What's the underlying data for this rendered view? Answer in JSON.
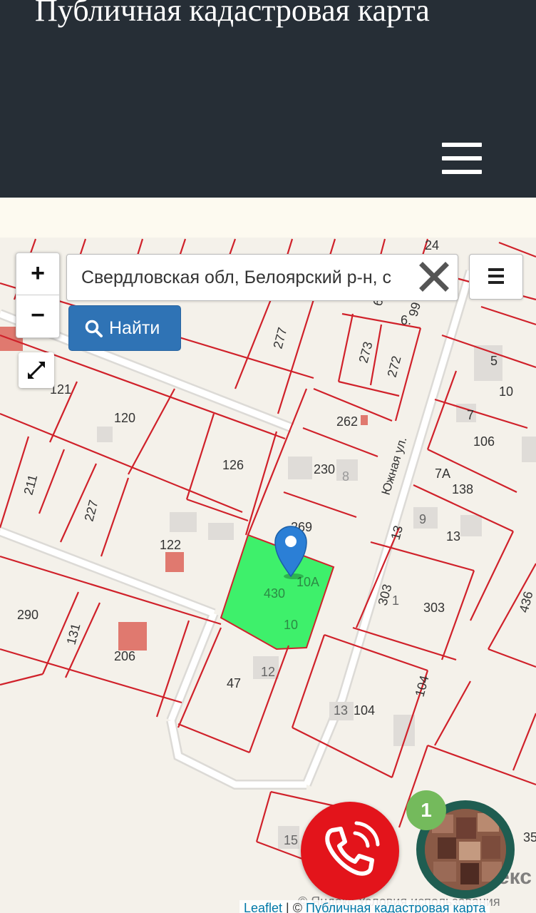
{
  "header": {
    "title": "Публичная кадастровая карта",
    "menu_icon": "hamburger-menu-icon",
    "background": "#262e36"
  },
  "map": {
    "zoom_in_label": "+",
    "zoom_out_label": "−",
    "search_value": "Свердловская обл, Белоярский р-н, с",
    "find_button_label": "Найти",
    "street_label": "Южная ул.",
    "selected_parcel": "430",
    "selected_color": "#3ef06b",
    "boundary_color": "#d0212a",
    "parcel_labels": [
      "24",
      "6",
      "99",
      "6.",
      "277",
      "273",
      "272",
      "5",
      "10",
      "121",
      "120",
      "262",
      "7",
      "106",
      "126",
      "230",
      "8",
      "7А",
      "138",
      "211",
      "227",
      "122",
      "269",
      "9",
      "13",
      "13",
      "10А",
      "430",
      "303",
      "1",
      "303",
      "436",
      "290",
      "131",
      "10",
      "206",
      "12",
      "47",
      "104",
      "13",
      "104",
      "15",
      "35"
    ]
  },
  "call_button": {
    "icon": "phone-icon",
    "color": "#e3141b"
  },
  "chat_widget": {
    "badge_count": "1",
    "badge_color": "#74ba5c"
  },
  "attribution": {
    "yandex_text": "© Яндекс  Условия использования",
    "yandex_logo": "екс",
    "leaflet_link": "Leaflet",
    "separator": " | © ",
    "pkk_link": "Публичная кадастровая карта"
  }
}
